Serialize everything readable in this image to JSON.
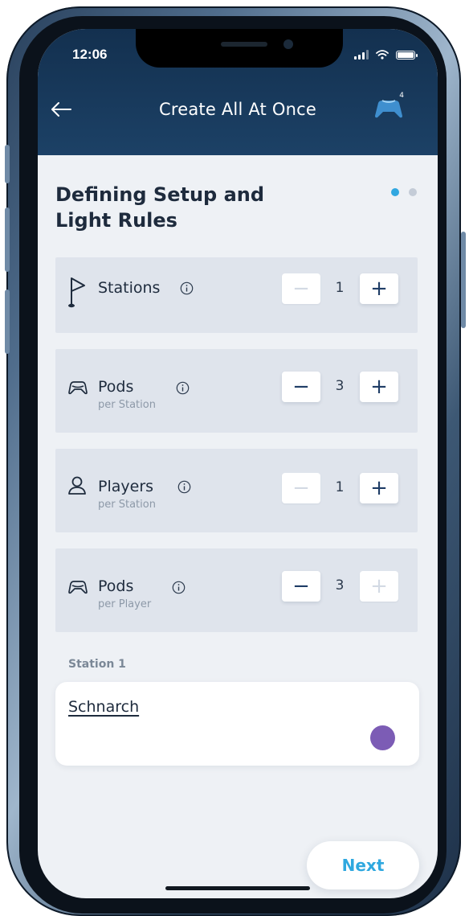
{
  "status_bar": {
    "time": "12:06"
  },
  "header": {
    "title": "Create All At Once",
    "back_icon": "arrow-left-icon",
    "controller_icon": "gamepad-icon",
    "controller_badge": "4"
  },
  "page": {
    "title": "Defining Setup and Light Rules",
    "pagination": {
      "total": 2,
      "current": 1
    }
  },
  "rules": [
    {
      "label": "Stations",
      "sub": "",
      "icon": "flag-icon",
      "value": "1",
      "minus_enabled": false,
      "plus_enabled": true
    },
    {
      "label": "Pods",
      "sub": "per Station",
      "icon": "pod-icon",
      "value": "3",
      "minus_enabled": true,
      "plus_enabled": true
    },
    {
      "label": "Players",
      "sub": "per Station",
      "icon": "user-icon",
      "value": "1",
      "minus_enabled": false,
      "plus_enabled": true
    },
    {
      "label": "Pods",
      "sub": "per Player",
      "icon": "pod-icon",
      "value": "3",
      "minus_enabled": true,
      "plus_enabled": false
    }
  ],
  "stepper": {
    "minus_label": "−",
    "plus_label": "+"
  },
  "station": {
    "section_label": "Station 1",
    "name": "Schnarch",
    "color": "#7c5cb5"
  },
  "footer": {
    "next_label": "Next"
  },
  "colors": {
    "header": "#17375a",
    "accent": "#2fa8df",
    "dot_active": "#31a7e0",
    "dot_inactive": "#c4ccd7",
    "card_bg": "#dfe4ec",
    "text_primary": "#1e2b3d"
  }
}
